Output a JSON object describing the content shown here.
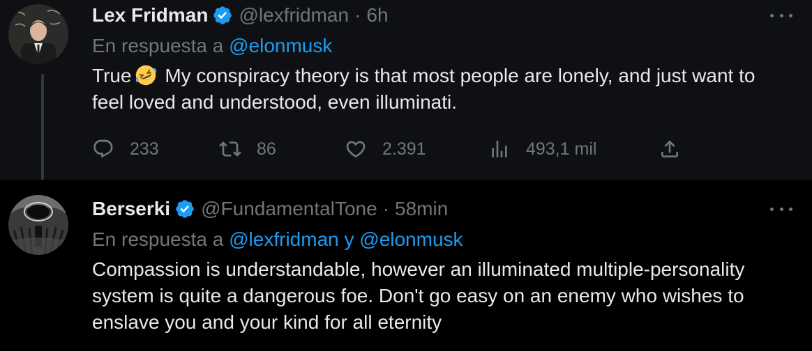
{
  "tweets": [
    {
      "name": "Lex Fridman",
      "handle": "@lexfridman",
      "dot": "·",
      "time": "6h",
      "reply_prefix": "En respuesta a",
      "reply_mention_1": "@elonmusk",
      "text_before_emoji": "True",
      "emoji": "rolling-on-floor-laughing-emoji",
      "text_after_emoji": " My conspiracy theory is that most people are lonely, and just want to feel loved and understood, even illuminati.",
      "actions": {
        "replies": "233",
        "retweets": "86",
        "likes": "2.391",
        "views": "493,1 mil"
      }
    },
    {
      "name": "Berserki",
      "handle": "@FundamentalTone",
      "dot": "·",
      "time": "58min",
      "reply_prefix": "En respuesta a",
      "reply_mentions": "@lexfridman y @elonmusk",
      "text": "Compassion is understandable, however an illuminated multiple-personality system is quite a dangerous foe. Don't go easy on an enemy who wishes to enslave you and your kind for all eternity"
    }
  ],
  "colors": {
    "background": "#000000",
    "text": "#e7e9ea",
    "secondary": "#71767b",
    "accent": "#1d9bf0"
  }
}
